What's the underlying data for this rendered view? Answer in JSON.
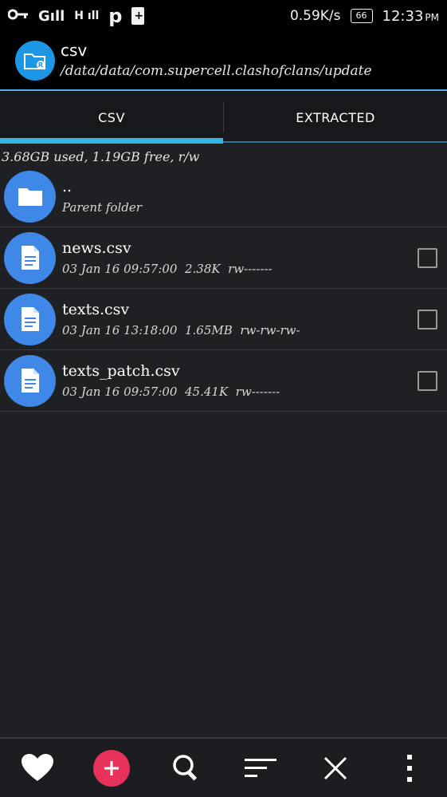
{
  "status_bar": {
    "signal_1": "Gıll",
    "signal_2": "ıll",
    "carrier_p": "p",
    "network_speed": "0.59K/s",
    "battery_level": "66",
    "time": "12:33",
    "ampm": "PM"
  },
  "header": {
    "title": "csv",
    "path": "/data/data/com.supercell.clashofclans/update",
    "accent": "#1e96e6"
  },
  "tabs": [
    {
      "label": "CSV",
      "active": true
    },
    {
      "label": "EXTRACTED",
      "active": false
    }
  ],
  "storage": {
    "info": "3.68GB used, 1.19GB free, r/w"
  },
  "files": [
    {
      "name": "..",
      "meta": "Parent folder",
      "type": "folder",
      "icon": "folder-icon",
      "checkbox": false
    },
    {
      "name": "news.csv",
      "meta": "03 Jan 16 09:57:00  2.38K  rw-------",
      "type": "file",
      "icon": "document-icon",
      "checkbox": true
    },
    {
      "name": "texts.csv",
      "meta": "03 Jan 16 13:18:00  1.65MB  rw-rw-rw-",
      "type": "file",
      "icon": "document-icon",
      "checkbox": true
    },
    {
      "name": "texts_patch.csv",
      "meta": "03 Jan 16 09:57:00  45.41K  rw-------",
      "type": "file",
      "icon": "document-icon",
      "checkbox": true
    }
  ],
  "toolbar": {
    "items": [
      "heart-icon",
      "add-icon",
      "search-icon",
      "sort-icon",
      "close-icon",
      "more-icon"
    ],
    "add_color": "#e8325c"
  }
}
